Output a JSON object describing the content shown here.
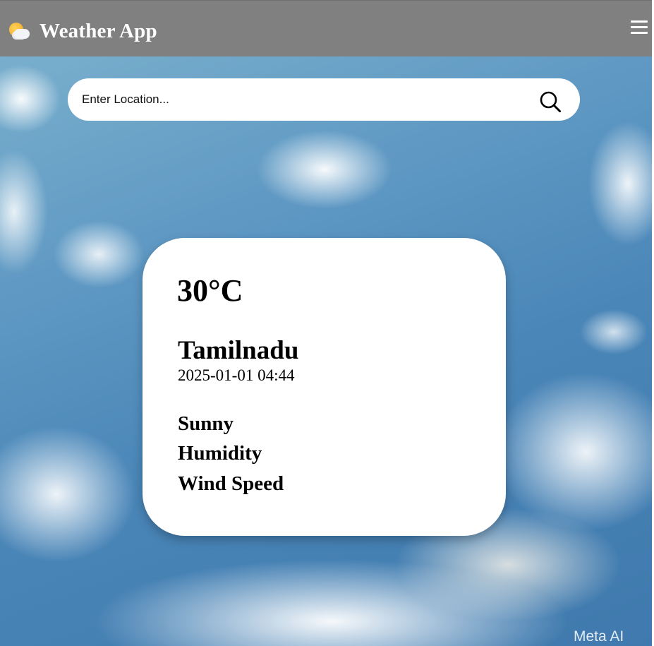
{
  "header": {
    "title": "Weather App",
    "logo_icon": "sun-behind-cloud-icon",
    "menu_icon": "hamburger-menu-icon",
    "background_color": "#808080"
  },
  "search": {
    "placeholder": "Enter Location...",
    "value": "",
    "icon": "search-icon"
  },
  "weather": {
    "temperature": "30°C",
    "location": "Tamilnadu",
    "datetime": "2025-01-01 04:44",
    "condition": "Sunny",
    "humidity_label": "Humidity",
    "wind_label": "Wind Speed"
  },
  "watermark": "Meta AI",
  "background": "cloudy-sky-image"
}
